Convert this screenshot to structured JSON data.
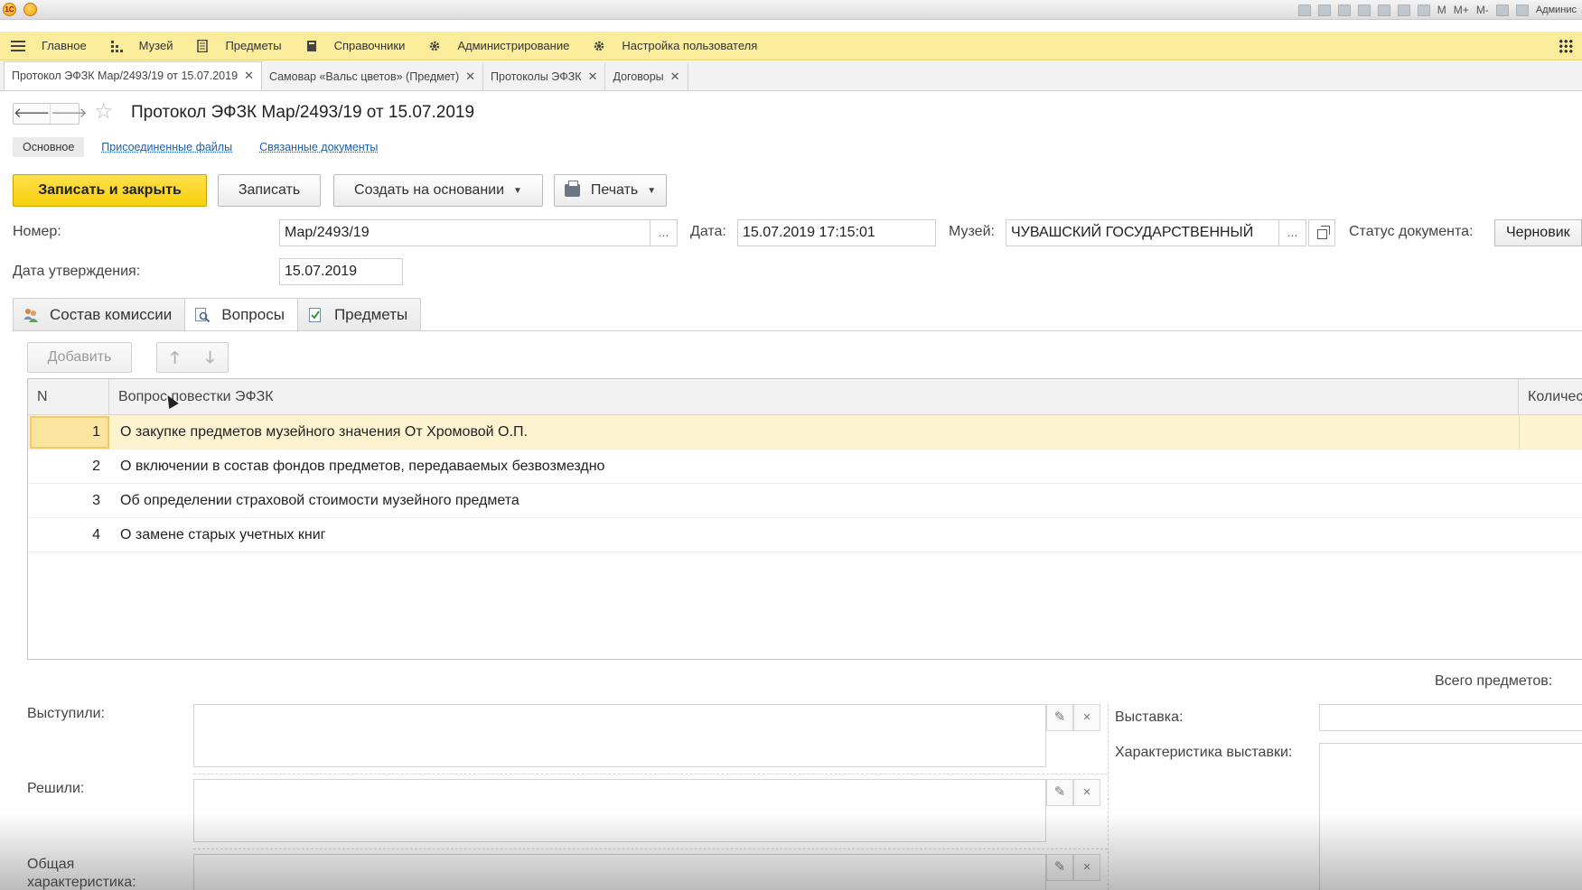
{
  "window": {
    "logo_text": "1С",
    "toolbar_items": [
      "M",
      "M+",
      "M-"
    ],
    "user": "Админис"
  },
  "sections": [
    {
      "label": "Главное",
      "icon": "menu-icon"
    },
    {
      "label": "Музей",
      "icon": "museum-icon"
    },
    {
      "label": "Предметы",
      "icon": "document-icon"
    },
    {
      "label": "Справочники",
      "icon": "book-icon"
    },
    {
      "label": "Администрирование",
      "icon": "gear-icon"
    },
    {
      "label": "Настройка пользователя",
      "icon": "gear-icon"
    }
  ],
  "open_tabs": [
    {
      "label": "Протокол ЭФЗК Мар/2493/19 от 15.07.2019",
      "active": true
    },
    {
      "label": "Самовар «Вальс цветов» (Предмет)",
      "active": false
    },
    {
      "label": "Протоколы ЭФЗК",
      "active": false
    },
    {
      "label": "Договоры",
      "active": false
    }
  ],
  "form": {
    "title": "Протокол ЭФЗК Мар/2493/19 от 15.07.2019",
    "tabs": [
      "Основное",
      "Присоединенные файлы",
      "Связанные документы"
    ],
    "buttons": {
      "save_close": "Записать и закрыть",
      "save": "Записать",
      "create_based": "Создать на основании",
      "print": "Печать"
    },
    "fields": {
      "number_label": "Номер:",
      "number_value": "Мар/2493/19",
      "date_label": "Дата:",
      "date_value": "15.07.2019 17:15:01",
      "museum_label": "Музей:",
      "museum_value": "ЧУВАШСКИЙ ГОСУДАРСТВЕННЫЙ",
      "status_label": "Статус документа:",
      "status_value": "Черновик",
      "approve_label": "Дата утверждения:",
      "approve_value": "15.07.2019",
      "choose_dots": "..."
    },
    "page_tabs": [
      {
        "label": "Состав комиссии",
        "icon": "people-icon"
      },
      {
        "label": "Вопросы",
        "icon": "search-doc-icon"
      },
      {
        "label": "Предметы",
        "icon": "checklist-icon"
      }
    ],
    "table": {
      "add_label": "Добавить",
      "columns": [
        "N",
        "Вопрос повестки ЭФЗК",
        "Количеств"
      ],
      "rows": [
        {
          "n": "1",
          "question": "О закупке предметов музейного значения От Хромовой О.П."
        },
        {
          "n": "2",
          "question": "О включении в состав фондов предметов, передаваемых безвозмездно"
        },
        {
          "n": "3",
          "question": "Об определении страховой стоимости музейного предмета"
        },
        {
          "n": "4",
          "question": "О замене старых учетных книг"
        }
      ]
    },
    "bottom": {
      "total_label": "Всего предметов:",
      "spoke_label": "Выступили:",
      "decided_label": "Решили:",
      "general_label": "Общая характеристика:",
      "exhibition_label": "Выставка:",
      "exhibition_char_label": "Характеристика выставки:"
    }
  }
}
